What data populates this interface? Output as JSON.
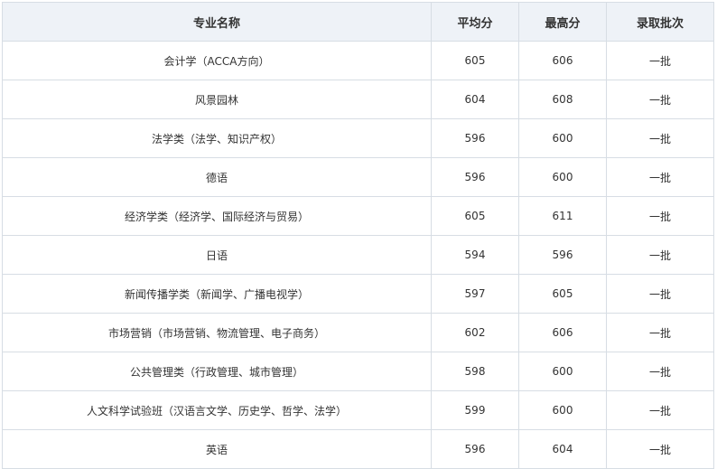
{
  "table": {
    "headers": [
      "专业名称",
      "平均分",
      "最高分",
      "录取批次"
    ],
    "rows": [
      {
        "major": "会计学（ACCA方向）",
        "avg": "605",
        "max": "606",
        "batch": "一批"
      },
      {
        "major": "风景园林",
        "avg": "604",
        "max": "608",
        "batch": "一批"
      },
      {
        "major": "法学类（法学、知识产权）",
        "avg": "596",
        "max": "600",
        "batch": "一批"
      },
      {
        "major": "德语",
        "avg": "596",
        "max": "600",
        "batch": "一批"
      },
      {
        "major": "经济学类（经济学、国际经济与贸易）",
        "avg": "605",
        "max": "611",
        "batch": "一批"
      },
      {
        "major": "日语",
        "avg": "594",
        "max": "596",
        "batch": "一批"
      },
      {
        "major": "新闻传播学类（新闻学、广播电视学）",
        "avg": "597",
        "max": "605",
        "batch": "一批"
      },
      {
        "major": "市场营销（市场营销、物流管理、电子商务）",
        "avg": "602",
        "max": "606",
        "batch": "一批"
      },
      {
        "major": "公共管理类（行政管理、城市管理）",
        "avg": "598",
        "max": "600",
        "batch": "一批"
      },
      {
        "major": "人文科学试验班（汉语言文学、历史学、哲学、法学）",
        "avg": "599",
        "max": "600",
        "batch": "一批"
      },
      {
        "major": "英语",
        "avg": "596",
        "max": "604",
        "batch": "一批"
      }
    ]
  },
  "colors": {
    "header_bg": "#eef2f7",
    "border": "#d7dde4",
    "text": "#333333"
  }
}
